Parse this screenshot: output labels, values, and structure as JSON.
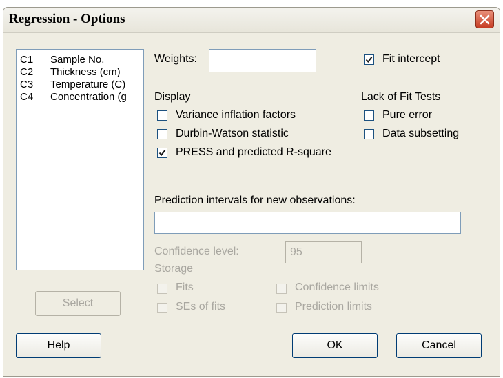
{
  "window": {
    "title": "Regression - Options"
  },
  "variables": [
    {
      "col": "C1",
      "name": "Sample No."
    },
    {
      "col": "C2",
      "name": "Thickness (cm)"
    },
    {
      "col": "C3",
      "name": "Temperature (C)"
    },
    {
      "col": "C4",
      "name": "Concentration (g"
    }
  ],
  "weights": {
    "label": "Weights:",
    "value": ""
  },
  "fit_intercept": {
    "label": "Fit intercept",
    "checked": true
  },
  "display": {
    "heading": "Display",
    "vif": {
      "label": "Variance inflation factors",
      "checked": false
    },
    "durbin_watson": {
      "label": "Durbin-Watson statistic",
      "checked": false
    },
    "press": {
      "label": "PRESS and predicted R-square",
      "checked": true
    }
  },
  "lack_of_fit": {
    "heading": "Lack of Fit Tests",
    "pure_error": {
      "label": "Pure error",
      "checked": false
    },
    "data_subsetting": {
      "label": "Data subsetting",
      "checked": false
    }
  },
  "prediction": {
    "label": "Prediction intervals for new observations:",
    "value": ""
  },
  "confidence": {
    "label": "Confidence level:",
    "value": "95"
  },
  "storage": {
    "heading": "Storage",
    "fits": "Fits",
    "ses_of_fits": "SEs of fits",
    "confidence_limits": "Confidence limits",
    "prediction_limits": "Prediction limits"
  },
  "buttons": {
    "select": "Select",
    "help": "Help",
    "ok": "OK",
    "cancel": "Cancel"
  },
  "icons": {
    "close": "close-icon",
    "check": "checkmark-icon"
  }
}
